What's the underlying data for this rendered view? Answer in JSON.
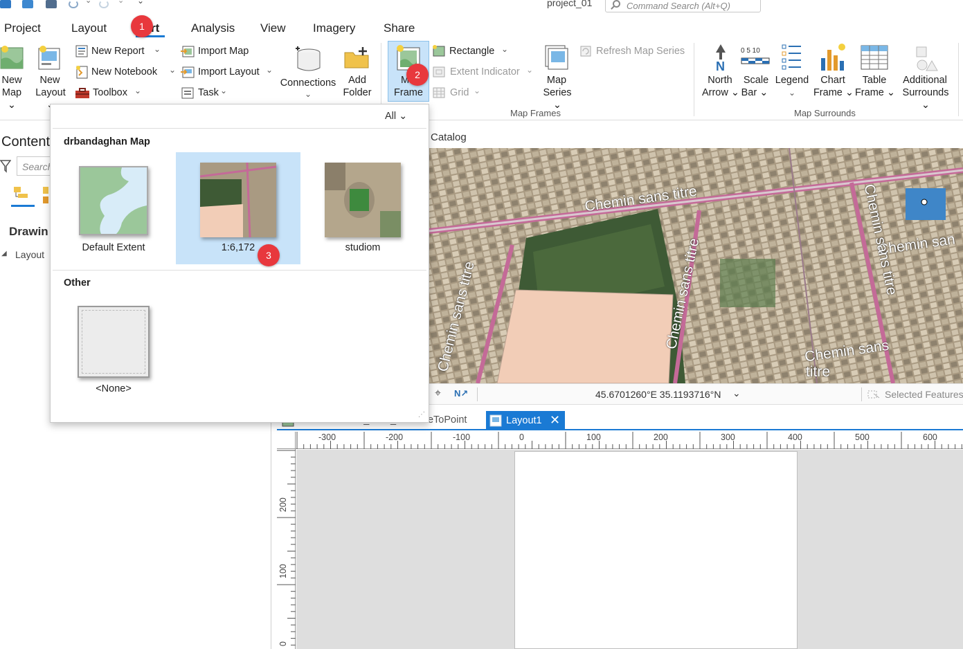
{
  "title_bar": {
    "project": "project_01",
    "search_placeholder": "Command Search (Alt+Q)"
  },
  "tabs": [
    "Project",
    "Layout",
    "Insert",
    "Analysis",
    "View",
    "Imagery",
    "Share"
  ],
  "tab_insert_visible": "rt",
  "ribbon": {
    "new_map": [
      "New",
      "Map"
    ],
    "new_layout": [
      "New",
      "Layout"
    ],
    "new_report": "New Report",
    "new_notebook": "New Notebook",
    "toolbox": "Toolbox",
    "import_map": "Import Map",
    "import_layout": "Import Layout",
    "task": "Task",
    "connections": "Connections",
    "add_folder": [
      "Add",
      "Folder"
    ],
    "map_frame": [
      "M",
      "Frame"
    ],
    "rectangle": "Rectangle",
    "extent_indicator": "Extent Indicator",
    "grid": "Grid",
    "map_series": [
      "Map",
      "Series"
    ],
    "refresh_map_series": "Refresh Map Series",
    "group_map_frames": "Map Frames",
    "north_arrow": [
      "North",
      "Arrow"
    ],
    "scale_bar": [
      "Scale",
      "Bar"
    ],
    "scale_bar_ticks": "0 5 10",
    "legend": "Legend",
    "chart_frame": [
      "Chart",
      "Frame"
    ],
    "table_frame": [
      "Table",
      "Frame"
    ],
    "additional_surrounds": [
      "Additional",
      "Surrounds"
    ],
    "group_map_surrounds": "Map Surrounds"
  },
  "contents": {
    "title": "Content",
    "search_placeholder": "Search",
    "drawing_order": "Drawin",
    "layout_item": "Layout"
  },
  "map": {
    "catalog_tab": "Catalog",
    "labels": [
      "Chemin sans titre",
      "Chemin sans titre",
      "Chemin sans titre",
      "Chemin san",
      "Chemin sans titre",
      "Chemin sans",
      "titre"
    ],
    "coords": "45.6701260°E 35.1193716°N",
    "selected_features": "Selected Features"
  },
  "layout_tabs": {
    "other": "Darbandikhan_GPS_XYTableToPoint",
    "active": "Layout1"
  },
  "ruler": {
    "top": [
      "-300",
      "-200",
      "-100",
      "0",
      "100",
      "200",
      "300",
      "400",
      "500",
      "600"
    ],
    "left": [
      "200",
      "100",
      "0"
    ]
  },
  "gallery": {
    "filter": "All",
    "section1": "drbandaghan Map",
    "items": [
      {
        "label": "Default Extent"
      },
      {
        "label": "1:6,172"
      },
      {
        "label": "studiom"
      }
    ],
    "section2": "Other",
    "none_label": "<None>"
  },
  "badges": [
    "1",
    "2",
    "3"
  ],
  "colors": {
    "accent": "#1a7ad4",
    "badge": "#e8383d",
    "selection": "#c8e3f9",
    "road": "#c46a98",
    "polygon": "#f2cdb7"
  }
}
